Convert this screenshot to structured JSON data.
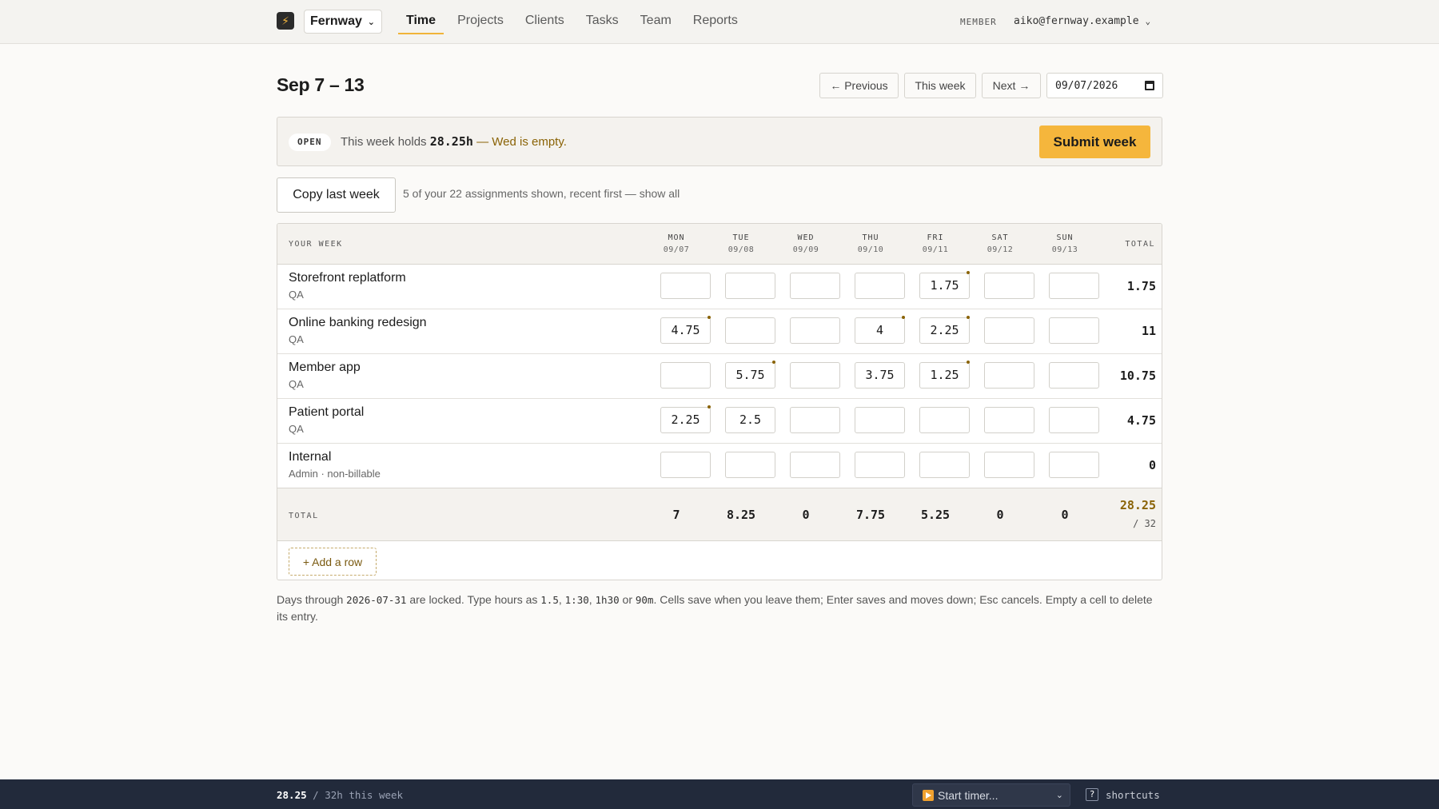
{
  "nav": {
    "logo_glyph": "⚡",
    "workspace": "Fernway",
    "tabs": [
      {
        "label": "Time",
        "active": true
      },
      {
        "label": "Projects",
        "active": false
      },
      {
        "label": "Clients",
        "active": false
      },
      {
        "label": "Tasks",
        "active": false
      },
      {
        "label": "Team",
        "active": false
      },
      {
        "label": "Reports",
        "active": false
      }
    ],
    "role": "MEMBER",
    "user": "aiko@fernway.example"
  },
  "week": {
    "title": "Sep 7 – 13",
    "prev_label": "← Previous",
    "this_label": "This week",
    "next_label": "Next →",
    "date_value": "09/07/2026"
  },
  "banner": {
    "status": "OPEN",
    "text_pre": "This week holds ",
    "hours": "28.25h",
    "warning": " — Wed is empty.",
    "submit_label": "Submit week"
  },
  "copy": {
    "label": "Copy last week",
    "note": "5 of your 22 assignments shown, recent first — show all"
  },
  "grid": {
    "header_label": "YOUR WEEK",
    "total_label": "TOTAL",
    "days": [
      {
        "name": "MON",
        "date": "09/07"
      },
      {
        "name": "TUE",
        "date": "09/08"
      },
      {
        "name": "WED",
        "date": "09/09"
      },
      {
        "name": "THU",
        "date": "09/10"
      },
      {
        "name": "FRI",
        "date": "09/11"
      },
      {
        "name": "SAT",
        "date": "09/12"
      },
      {
        "name": "SUN",
        "date": "09/13"
      }
    ],
    "rows": [
      {
        "project": "Storefront replatform",
        "task": "QA",
        "cells": [
          "",
          "",
          "",
          "",
          "1.75",
          "",
          ""
        ],
        "noted": [
          false,
          false,
          false,
          false,
          true,
          false,
          false
        ],
        "total": "1.75"
      },
      {
        "project": "Online banking redesign",
        "task": "QA",
        "cells": [
          "4.75",
          "",
          "",
          "4",
          "2.25",
          "",
          ""
        ],
        "noted": [
          true,
          false,
          false,
          true,
          true,
          false,
          false
        ],
        "total": "11"
      },
      {
        "project": "Member app",
        "task": "QA",
        "cells": [
          "",
          "5.75",
          "",
          "3.75",
          "1.25",
          "",
          ""
        ],
        "noted": [
          false,
          true,
          false,
          false,
          true,
          false,
          false
        ],
        "total": "10.75"
      },
      {
        "project": "Patient portal",
        "task": "QA",
        "cells": [
          "2.25",
          "2.5",
          "",
          "",
          "",
          "",
          ""
        ],
        "noted": [
          true,
          false,
          false,
          false,
          false,
          false,
          false
        ],
        "total": "4.75"
      },
      {
        "project": "Internal",
        "task": "Admin  · non-billable",
        "cells": [
          "",
          "",
          "",
          "",
          "",
          "",
          ""
        ],
        "noted": [
          false,
          false,
          false,
          false,
          false,
          false,
          false
        ],
        "total": "0"
      }
    ],
    "day_totals": [
      "7",
      "8.25",
      "0",
      "7.75",
      "5.25",
      "0",
      "0"
    ],
    "grand_total": "28.25",
    "target": "/ 32",
    "add_row_label": "+ Add a row"
  },
  "footnote": {
    "p1": "Days through ",
    "locked_date": "2026-07-31",
    "p2": " are locked.   Type hours as ",
    "f1": "1.5",
    "s1": ", ",
    "f2": "1:30",
    "s2": ", ",
    "f3": "1h30",
    "s3": " or ",
    "f4": "90m",
    "p3": ". Cells save when you leave them; Enter saves and moves down; Esc cancels. Empty a cell to delete its entry."
  },
  "bottom": {
    "week_hours": "28.25",
    "week_target": " / 32h this week",
    "timer_label": "Start timer...",
    "shortcut_key": "?",
    "shortcut_label": "shortcuts"
  },
  "colors": {
    "accent": "#f5b63c",
    "warning_text": "#8a6306",
    "bottom_bar": "#222a3b"
  }
}
